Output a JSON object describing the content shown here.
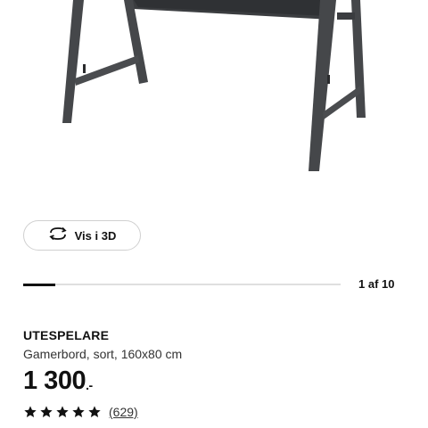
{
  "gallery": {
    "vis3d_label": "Vis i 3D",
    "current_image": 1,
    "total_images": 10,
    "counter_text": "1 af 10",
    "progress_fraction": 0.1
  },
  "product": {
    "name": "UTESPELARE",
    "description": "Gamerbord, sort, 160x80 cm",
    "price": "1 300",
    "price_suffix": ".-",
    "rating_stars": 5,
    "review_count_text": "(629)"
  },
  "icons": {
    "rotate": "rotate-3d-icon",
    "star": "star-icon"
  },
  "colors": {
    "text": "#111111",
    "progress_active": "#111111",
    "progress_track": "#dfdfdf",
    "desk_frame": "#3b3d40"
  }
}
